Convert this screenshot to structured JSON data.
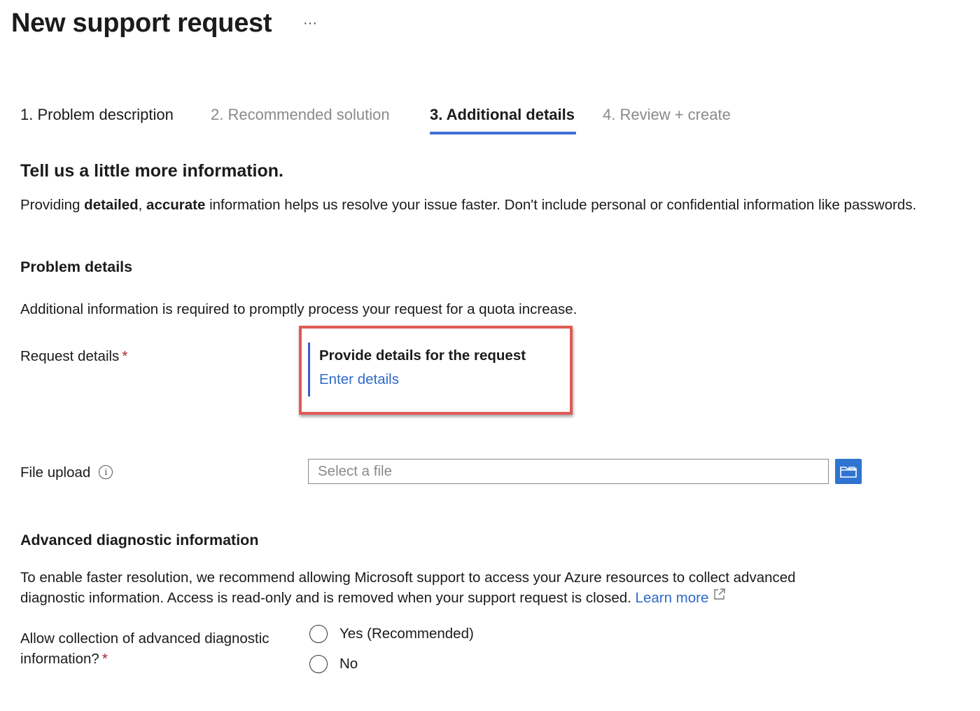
{
  "header": {
    "title": "New support request",
    "more_label": "···"
  },
  "tabs": [
    {
      "label": "1. Problem description",
      "state": "done"
    },
    {
      "label": "2. Recommended solution",
      "state": "disabled"
    },
    {
      "label": "3. Additional details",
      "state": "active"
    },
    {
      "label": "4. Review + create",
      "state": "disabled"
    }
  ],
  "intro": {
    "heading": "Tell us a little more information.",
    "text_part1": "Providing ",
    "bold1": "detailed",
    "text_part2": ", ",
    "bold2": "accurate",
    "text_part3": " information helps us resolve your issue faster. Don't include personal or confidential information like passwords."
  },
  "problem_details": {
    "heading": "Problem details",
    "description": "Additional information is required to promptly process your request for a quota increase.",
    "request_label": "Request details",
    "required_marker": "*",
    "card_title": "Provide details for the request",
    "card_link": "Enter details",
    "file_label": "File upload",
    "info_icon": "i",
    "file_placeholder": "Select a file"
  },
  "diagnostics": {
    "heading": "Advanced diagnostic information",
    "description_line1": "To enable faster resolution, we recommend allowing Microsoft support to access your Azure resources to collect advanced",
    "description_line2": "diagnostic information. Access is read-only and is removed when your support request is closed.",
    "learn_more": "Learn more",
    "question_line1": "Allow collection of advanced diagnostic",
    "question_line2": "information?",
    "required_marker": "*",
    "options": [
      {
        "label": "Yes (Recommended)",
        "selected": false
      },
      {
        "label": "No",
        "selected": false
      }
    ]
  },
  "colors": {
    "accent": "#3f6fd1",
    "link": "#2f6ac8",
    "required": "#a4262c",
    "highlight": "#e05a55",
    "button": "#2f74d0"
  },
  "icons": {
    "more": "more-icon",
    "info": "info-icon",
    "browse": "folder-icon",
    "external": "external-link-icon"
  }
}
